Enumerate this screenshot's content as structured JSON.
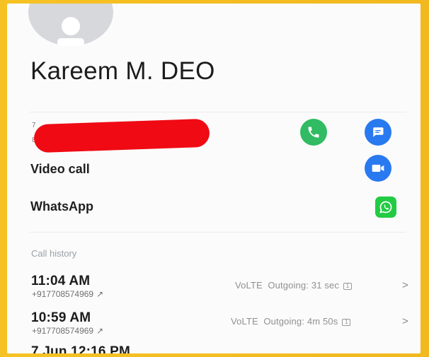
{
  "contact": {
    "name": "Kareem M. DEO",
    "masked_number_hint": "",
    "tiny_prefix_top": "7",
    "tiny_prefix_bottom": "8"
  },
  "actions": {
    "video_call_label": "Video call",
    "whatsapp_label": "WhatsApp"
  },
  "history": {
    "title": "Call history",
    "items": [
      {
        "time": "11:04 AM",
        "number": "+917708574969",
        "direction_icon": "↗",
        "network": "VoLTE",
        "status": "Outgoing: 31 sec",
        "sim": "1"
      },
      {
        "time": "10:59 AM",
        "number": "+917708574969",
        "direction_icon": "↗",
        "network": "VoLTE",
        "status": "Outgoing: 4m 50s",
        "sim": "1"
      },
      {
        "time": "7 Jun 12:16 PM",
        "number": "",
        "direction_icon": "",
        "network": "",
        "status": "",
        "sim": ""
      }
    ]
  },
  "colors": {
    "call_green": "#31bb63",
    "message_blue": "#2979f0",
    "whatsapp_green": "#22cb43",
    "redaction_red": "#ef0a14",
    "frame_yellow": "#f4c21a"
  }
}
